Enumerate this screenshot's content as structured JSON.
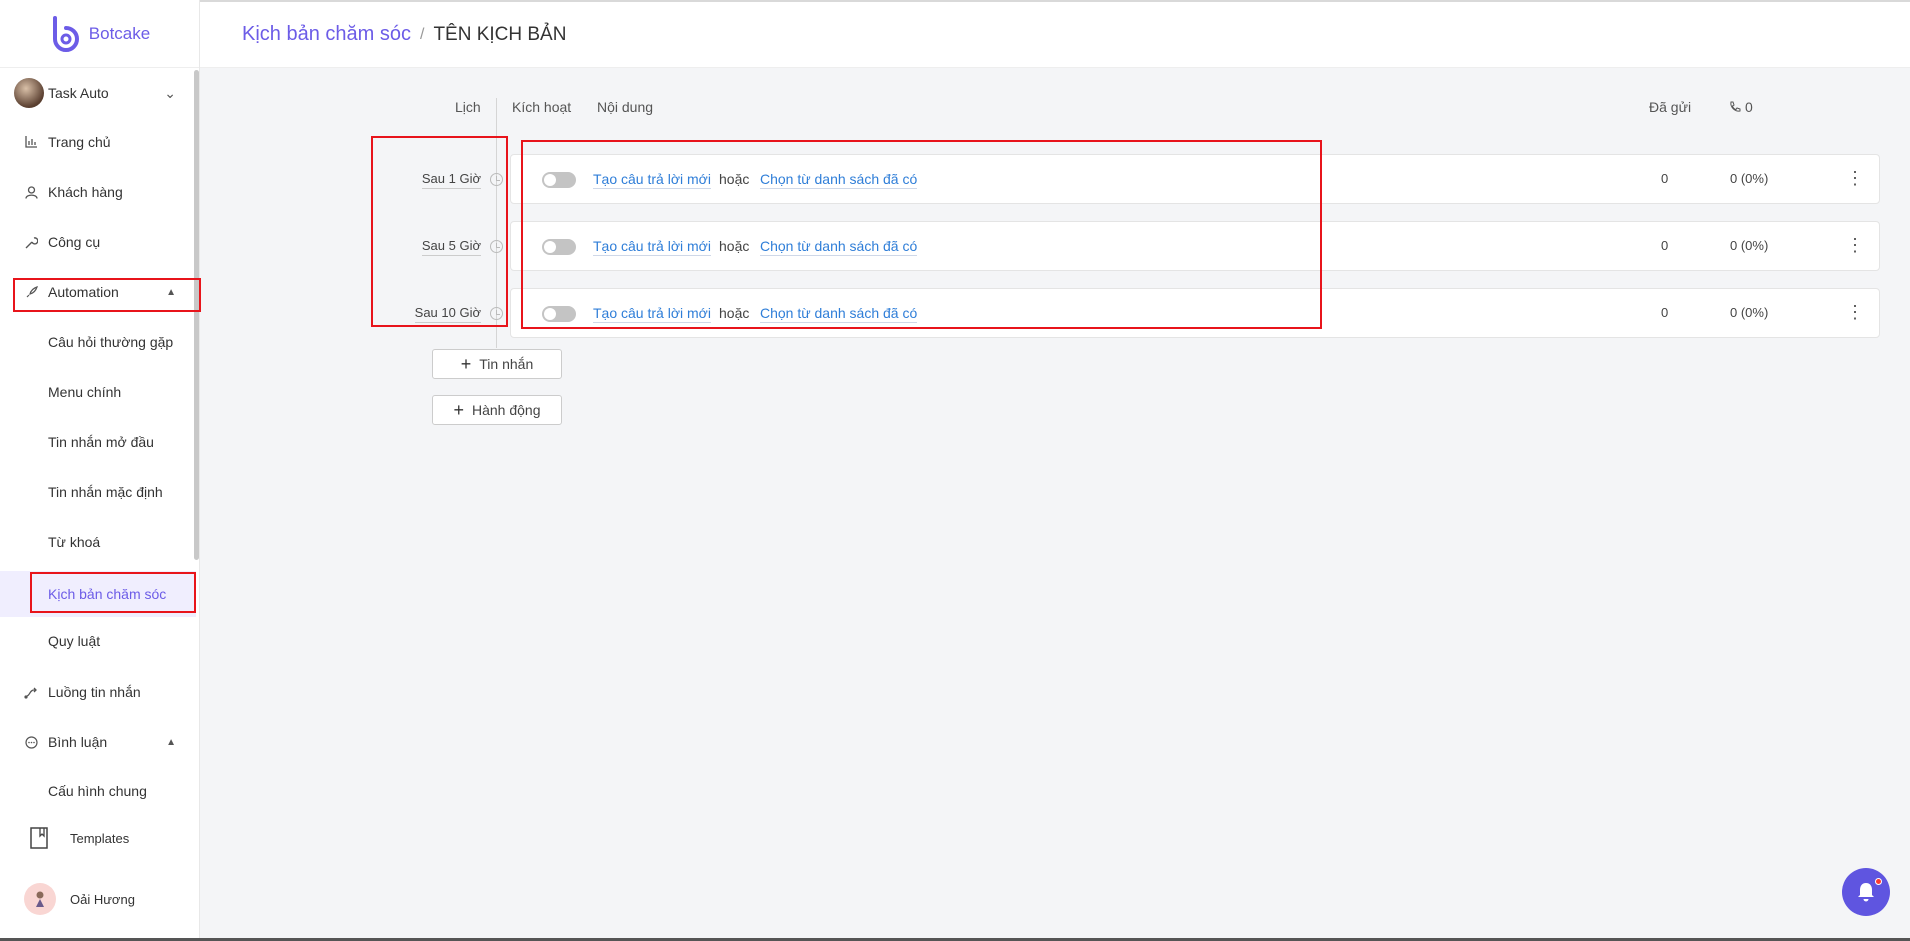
{
  "app": {
    "brand": "Botcake",
    "accent": "#6c5ce7"
  },
  "sidebar": {
    "account": "Task Auto",
    "items": {
      "home": "Trang chủ",
      "customers": "Khách hàng",
      "tools": "Công cụ",
      "automation": "Automation",
      "faq": "Câu hỏi thường gặp",
      "main_menu": "Menu chính",
      "welcome": "Tin nhắn mở đầu",
      "default_msg": "Tin nhắn mặc định",
      "keywords": "Từ khoá",
      "care_script": "Kịch bản chăm sóc",
      "rules": "Quy luật",
      "flows": "Luồng tin nhắn",
      "comments": "Bình luận",
      "general_config": "Cấu hình chung",
      "templates": "Templates"
    },
    "user": "Oải Hương"
  },
  "header": {
    "breadcrumb_link": "Kịch bản chăm sóc",
    "separator": "/",
    "current": "TÊN KỊCH BẢN"
  },
  "table": {
    "headers": {
      "schedule": "Lịch",
      "active": "Kích hoạt",
      "content": "Nội dung",
      "sent": "Đã gửi",
      "replied": "0"
    },
    "rows": [
      {
        "schedule": "Sau 1 Giờ",
        "create": "Tạo câu trả lời mới",
        "or": "hoặc",
        "choose": "Chọn từ danh sách đã có",
        "sent": "0",
        "rate": "0 (0%)"
      },
      {
        "schedule": "Sau 5 Giờ",
        "create": "Tạo câu trả lời mới",
        "or": "hoặc",
        "choose": "Chọn từ danh sách đã có",
        "sent": "0",
        "rate": "0 (0%)"
      },
      {
        "schedule": "Sau 10 Giờ",
        "create": "Tạo câu trả lời mới",
        "or": "hoặc",
        "choose": "Chọn từ danh sách đã có",
        "sent": "0",
        "rate": "0 (0%)"
      }
    ]
  },
  "buttons": {
    "add_message": "Tin nhắn",
    "add_action": "Hành động"
  }
}
